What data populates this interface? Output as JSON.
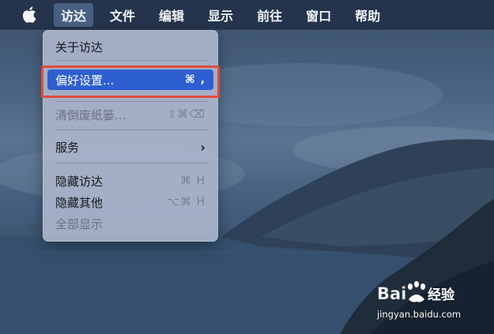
{
  "menubar": {
    "items": [
      {
        "label": "访达",
        "active": true
      },
      {
        "label": "文件"
      },
      {
        "label": "编辑"
      },
      {
        "label": "显示"
      },
      {
        "label": "前往"
      },
      {
        "label": "窗口"
      },
      {
        "label": "帮助"
      }
    ]
  },
  "dropdown": {
    "items": [
      {
        "label": "关于访达",
        "shortcut": ""
      },
      {
        "label": "偏好设置...",
        "shortcut": "⌘ ,"
      },
      {
        "label": "清倒废纸篓...",
        "shortcut": "⇧⌘⌫"
      },
      {
        "label": "服务",
        "shortcut": "›"
      },
      {
        "label": "隐藏访达",
        "shortcut": "⌘ H"
      },
      {
        "label": "隐藏其他",
        "shortcut": "⌥⌘ H"
      },
      {
        "label": "全部显示",
        "shortcut": ""
      }
    ]
  },
  "watermark": {
    "logo_text": "Baidu经验",
    "url": "jingyan.baidu.com"
  },
  "colors": {
    "menubar_bg": "#223048",
    "selection": "#2e5fd0",
    "highlight_box": "#e34a3a"
  }
}
